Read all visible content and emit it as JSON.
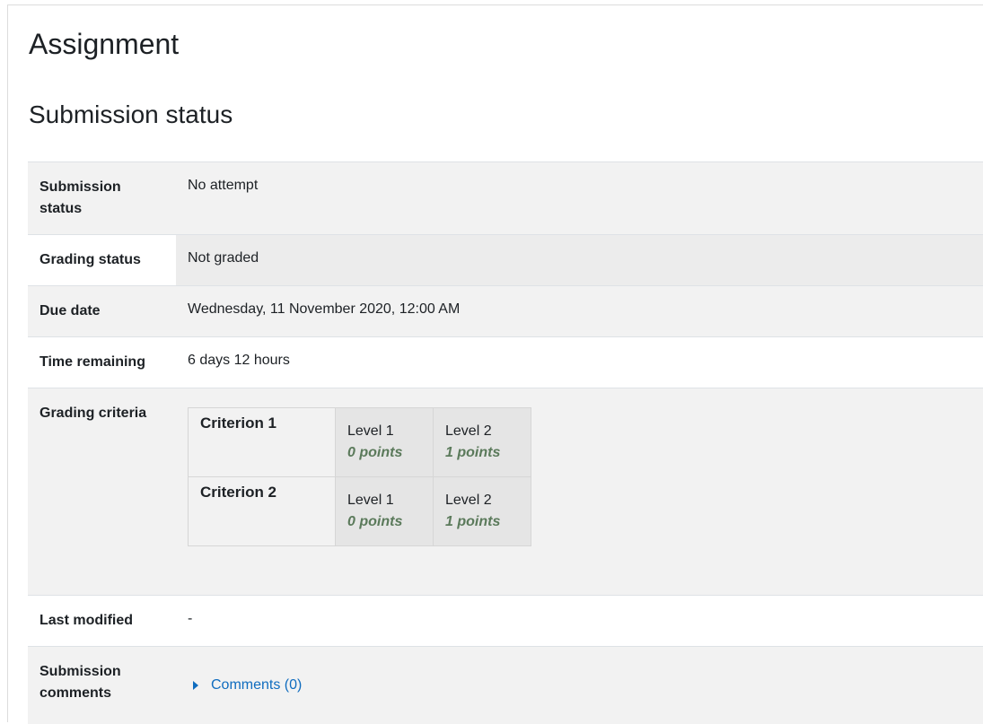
{
  "page": {
    "title": "Assignment",
    "section_title": "Submission status"
  },
  "rows": {
    "submission_status": {
      "label_line1": "Submission",
      "label_line2": "status",
      "value": "No attempt"
    },
    "grading_status": {
      "label": "Grading status",
      "value": "Not graded"
    },
    "due_date": {
      "label": "Due date",
      "value": "Wednesday, 11 November 2020, 12:00 AM"
    },
    "time_remaining": {
      "label": "Time remaining",
      "value": "6 days 12 hours"
    },
    "grading_criteria": {
      "label": "Grading criteria"
    },
    "last_modified": {
      "label": "Last modified",
      "value": "-"
    },
    "submission_comments": {
      "label_line1": "Submission",
      "label_line2": "comments",
      "link": "Comments (0)"
    }
  },
  "rubric": {
    "criteria": [
      {
        "name": "Criterion 1",
        "levels": [
          {
            "label": "Level 1",
            "points": "0 points"
          },
          {
            "label": "Level 2",
            "points": "1 points"
          }
        ]
      },
      {
        "name": "Criterion 2",
        "levels": [
          {
            "label": "Level 1",
            "points": "0 points"
          },
          {
            "label": "Level 2",
            "points": "1 points"
          }
        ]
      }
    ]
  },
  "colors": {
    "link": "#0f6cbf",
    "points": "#5b7a5b",
    "row_shade": "#f2f2f2"
  },
  "icons": {
    "comments_toggle": "caret-right-icon"
  }
}
